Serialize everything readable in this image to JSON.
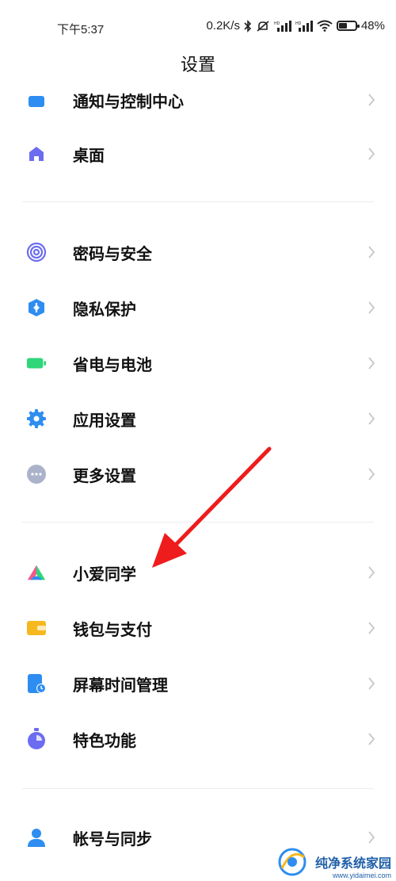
{
  "status_bar": {
    "time": "下午5:37",
    "net_speed": "0.2K/s",
    "battery": "48%",
    "battery_level": 0.48
  },
  "title": "设置",
  "items": {
    "notifications": "通知与控制中心",
    "desktop": "桌面",
    "security": "密码与安全",
    "privacy": "隐私保护",
    "battery": "省电与电池",
    "apps": "应用设置",
    "more": "更多设置",
    "xiaoai": "小爱同学",
    "wallet": "钱包与支付",
    "screen_time": "屏幕时间管理",
    "features": "特色功能",
    "account": "帐号与同步"
  },
  "watermark": {
    "text": "纯净系统家园",
    "url": "www.yidaimei.com"
  },
  "colors": {
    "blue": "#2e8df0",
    "purple": "#6c6cf0",
    "green": "#2fd67a",
    "gray": "#8e9ab8",
    "yellow": "#f5b81f",
    "arrow_red": "#ee1c1c"
  }
}
